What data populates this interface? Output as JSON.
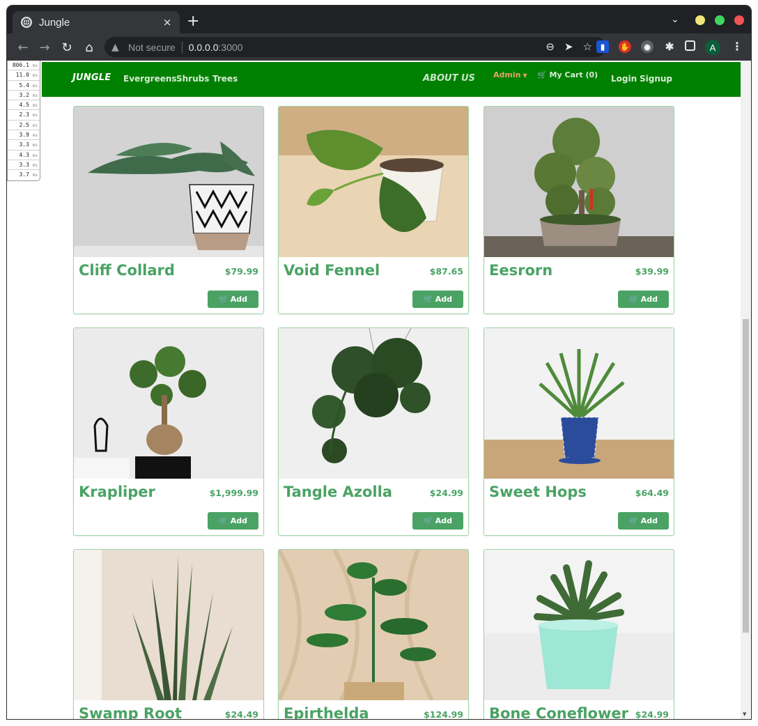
{
  "browser": {
    "tab_title": "Jungle",
    "tab_close": "×",
    "new_tab": "+",
    "security_label": "Not secure",
    "url_host": "0.0.0.0",
    "url_port": ":3000",
    "profile_initial": "A",
    "icons": [
      "globe-icon",
      "back-icon",
      "forward-icon",
      "reload-icon",
      "home-icon",
      "warning-icon",
      "zoom-out-icon",
      "send-icon",
      "star-icon",
      "puzzle-icon",
      "sidebar-icon",
      "menu-icon"
    ]
  },
  "timings": [
    {
      "value": "806.1",
      "unit": "ms"
    },
    {
      "value": "11.0",
      "unit": "ms"
    },
    {
      "value": "5.4",
      "unit": "ms"
    },
    {
      "value": "3.2",
      "unit": "ms"
    },
    {
      "value": "4.5",
      "unit": "ms"
    },
    {
      "value": "2.3",
      "unit": "ms"
    },
    {
      "value": "2.5",
      "unit": "ms"
    },
    {
      "value": "3.9",
      "unit": "ms"
    },
    {
      "value": "3.3",
      "unit": "ms"
    },
    {
      "value": "4.3",
      "unit": "ms"
    },
    {
      "value": "3.3",
      "unit": "ms"
    },
    {
      "value": "3.7",
      "unit": "ms"
    }
  ],
  "site_nav": {
    "brand": "JUNGLE",
    "categories": [
      "Evergreens",
      "Shrubs",
      "Trees"
    ],
    "about": "ABOUT US",
    "admin": "Admin",
    "cart": "My Cart (0)",
    "login": "Login",
    "signup": "Signup"
  },
  "add_label": "Add",
  "accent_color": "#4aa364",
  "nav_color": "#008000",
  "products": [
    {
      "name": "Cliff Collard",
      "price": "$79.99"
    },
    {
      "name": "Void Fennel",
      "price": "$87.65"
    },
    {
      "name": "Eesrorn",
      "price": "$39.99"
    },
    {
      "name": "Krapliper",
      "price": "$1,999.99"
    },
    {
      "name": "Tangle Azolla",
      "price": "$24.99"
    },
    {
      "name": "Sweet Hops",
      "price": "$64.49"
    },
    {
      "name": "Swamp Root",
      "price": "$24.49"
    },
    {
      "name": "Epirthelda",
      "price": "$124.99"
    },
    {
      "name": "Bone Coneflower",
      "price": "$24.99"
    }
  ]
}
